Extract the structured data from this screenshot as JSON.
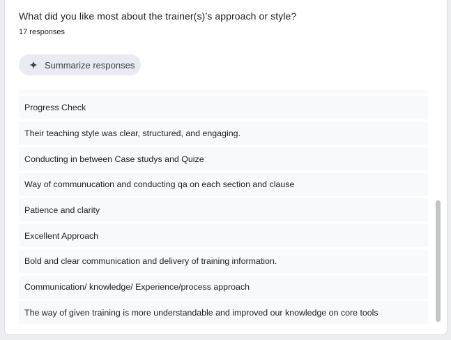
{
  "question": {
    "title": "What did you like most about the trainer(s)’s approach or style?",
    "response_count": "17 responses"
  },
  "summarize": {
    "icon": "sparkle-icon",
    "label": "Summarize responses"
  },
  "responses": [
    "",
    "Progress Check",
    "Their teaching style was clear, structured, and engaging.",
    "Conducting in between Case studys and Quize",
    "Way of communucation and conducting qa on each section and clause",
    "Patience and clarity",
    "Excellent Approach",
    "Bold and clear communication and delivery of training information.",
    "Communication/ knowledge/ Experience/process approach",
    "The way of given training is more understandable and improved our knowledge on core tools"
  ],
  "colors": {
    "item_background": "#f8f9fa",
    "button_background": "#e8ebf2",
    "text": "#202124"
  }
}
